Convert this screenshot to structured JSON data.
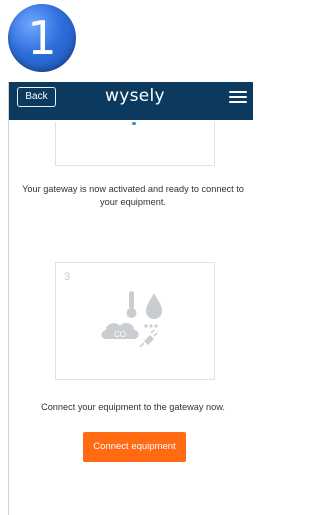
{
  "step": {
    "number": "1"
  },
  "header": {
    "back_label": "Back",
    "logo_text": "wysely",
    "menu_icon": "hamburger-menu-icon",
    "background_color": "#0b3a5e"
  },
  "main": {
    "activated_message": "Your gateway is now activated and ready to connect to your equipment.",
    "step_card": {
      "number": "3",
      "illustration_icon": "equipment-sensors-icon",
      "cloud_label": "CO"
    },
    "connect_message": "Connect your equipment to the gateway now.",
    "connect_button_label": "Connect equipment",
    "accent_color": "#ff6a13"
  }
}
